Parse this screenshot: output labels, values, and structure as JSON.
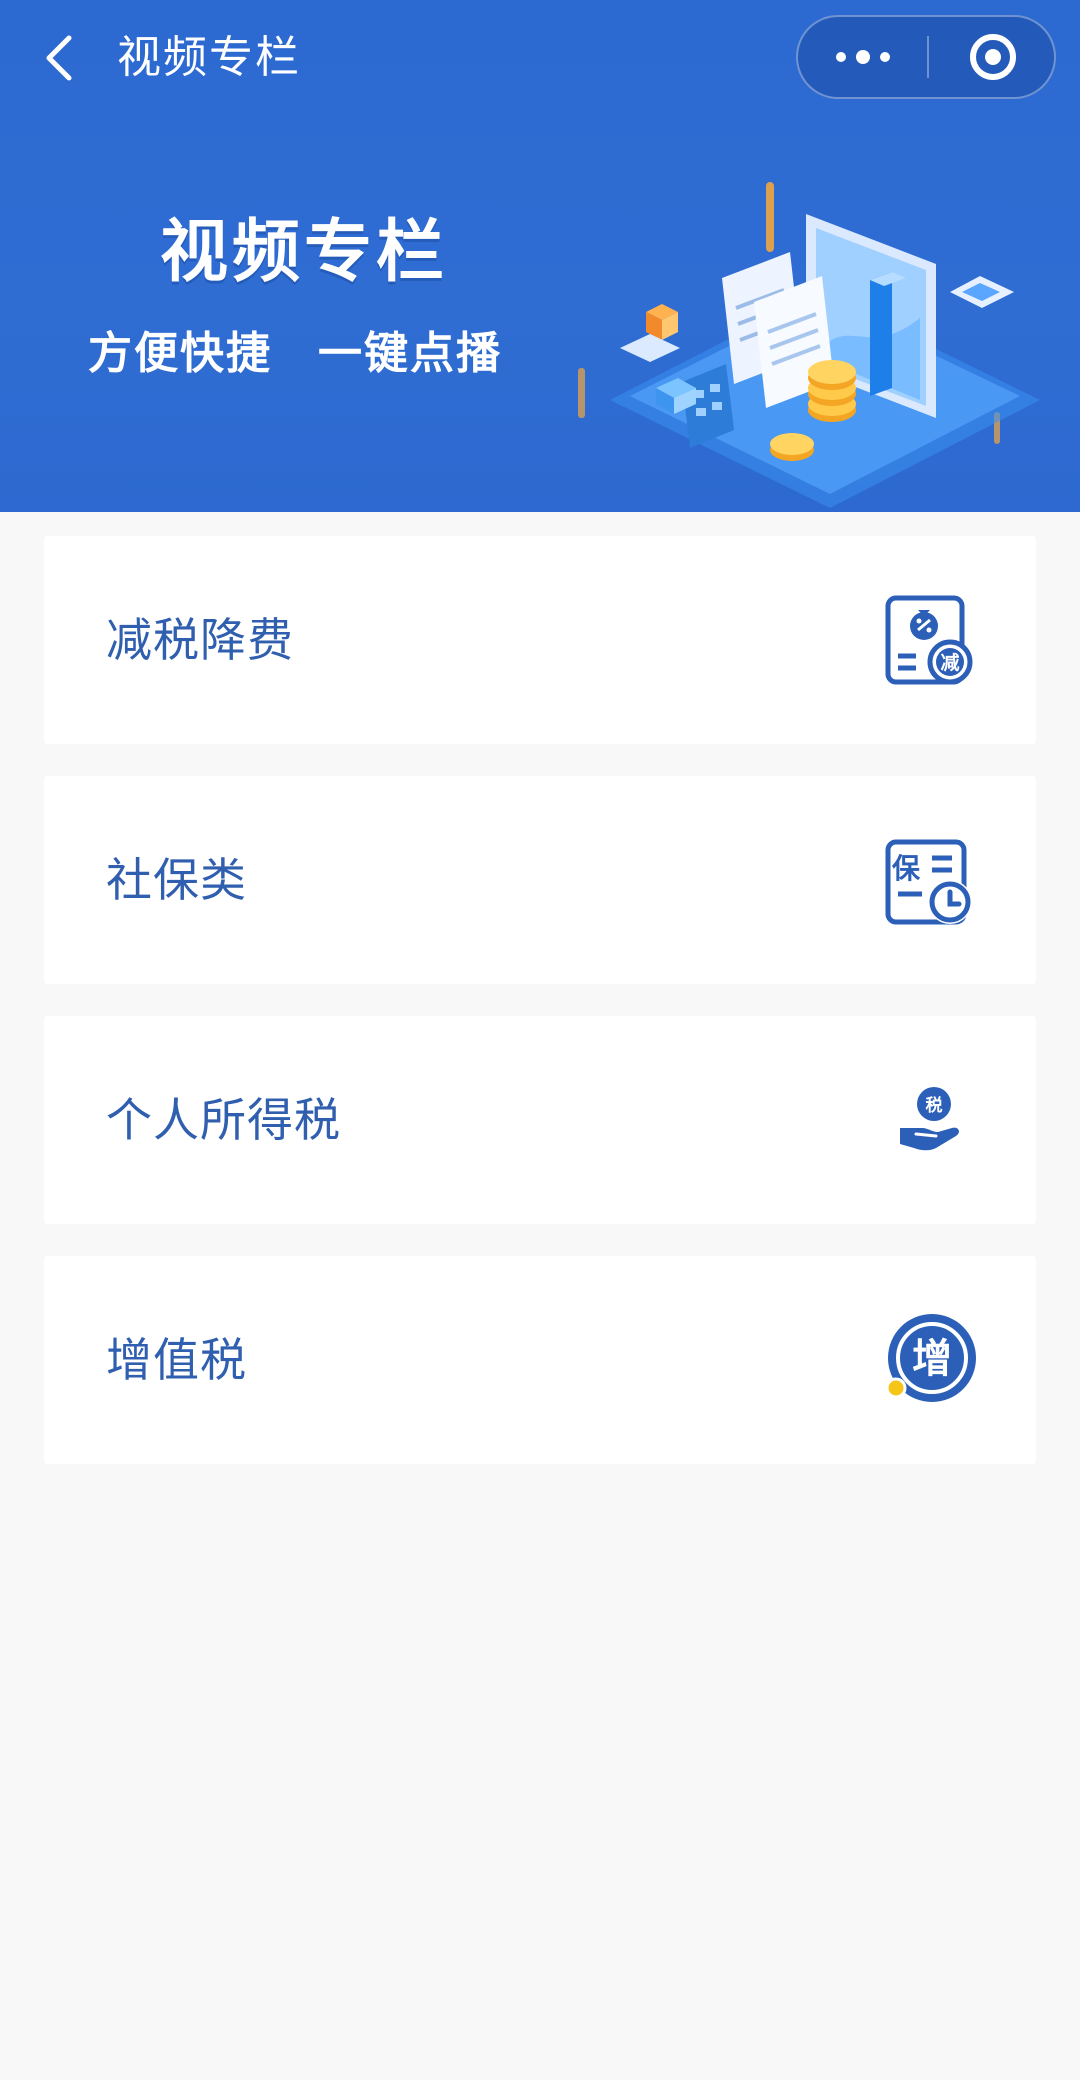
{
  "navbar": {
    "title": "视频专栏",
    "back_icon": "chevron-left-icon",
    "more_icon": "more-dots-icon",
    "close_icon": "target-circle-icon"
  },
  "banner": {
    "title": "视频专栏",
    "subtitle_left": "方便快捷",
    "subtitle_right": "一键点播"
  },
  "categories": [
    {
      "label": "减税降费",
      "icon": "tax-reduction-document-icon"
    },
    {
      "label": "社保类",
      "icon": "social-security-clock-icon"
    },
    {
      "label": "个人所得税",
      "icon": "hand-tax-icon"
    },
    {
      "label": "增值税",
      "icon": "vat-circle-icon",
      "icon_text": "增"
    }
  ],
  "icon_glyphs": {
    "reduction": "减",
    "insurance": "保",
    "tax": "税"
  },
  "colors": {
    "brand_blue": "#2c6ad2",
    "label_blue": "#2f5fae",
    "icon_blue": "#2b5fb8",
    "accent_yellow": "#f5c518",
    "background": "#f8f8f8",
    "card": "#ffffff"
  }
}
